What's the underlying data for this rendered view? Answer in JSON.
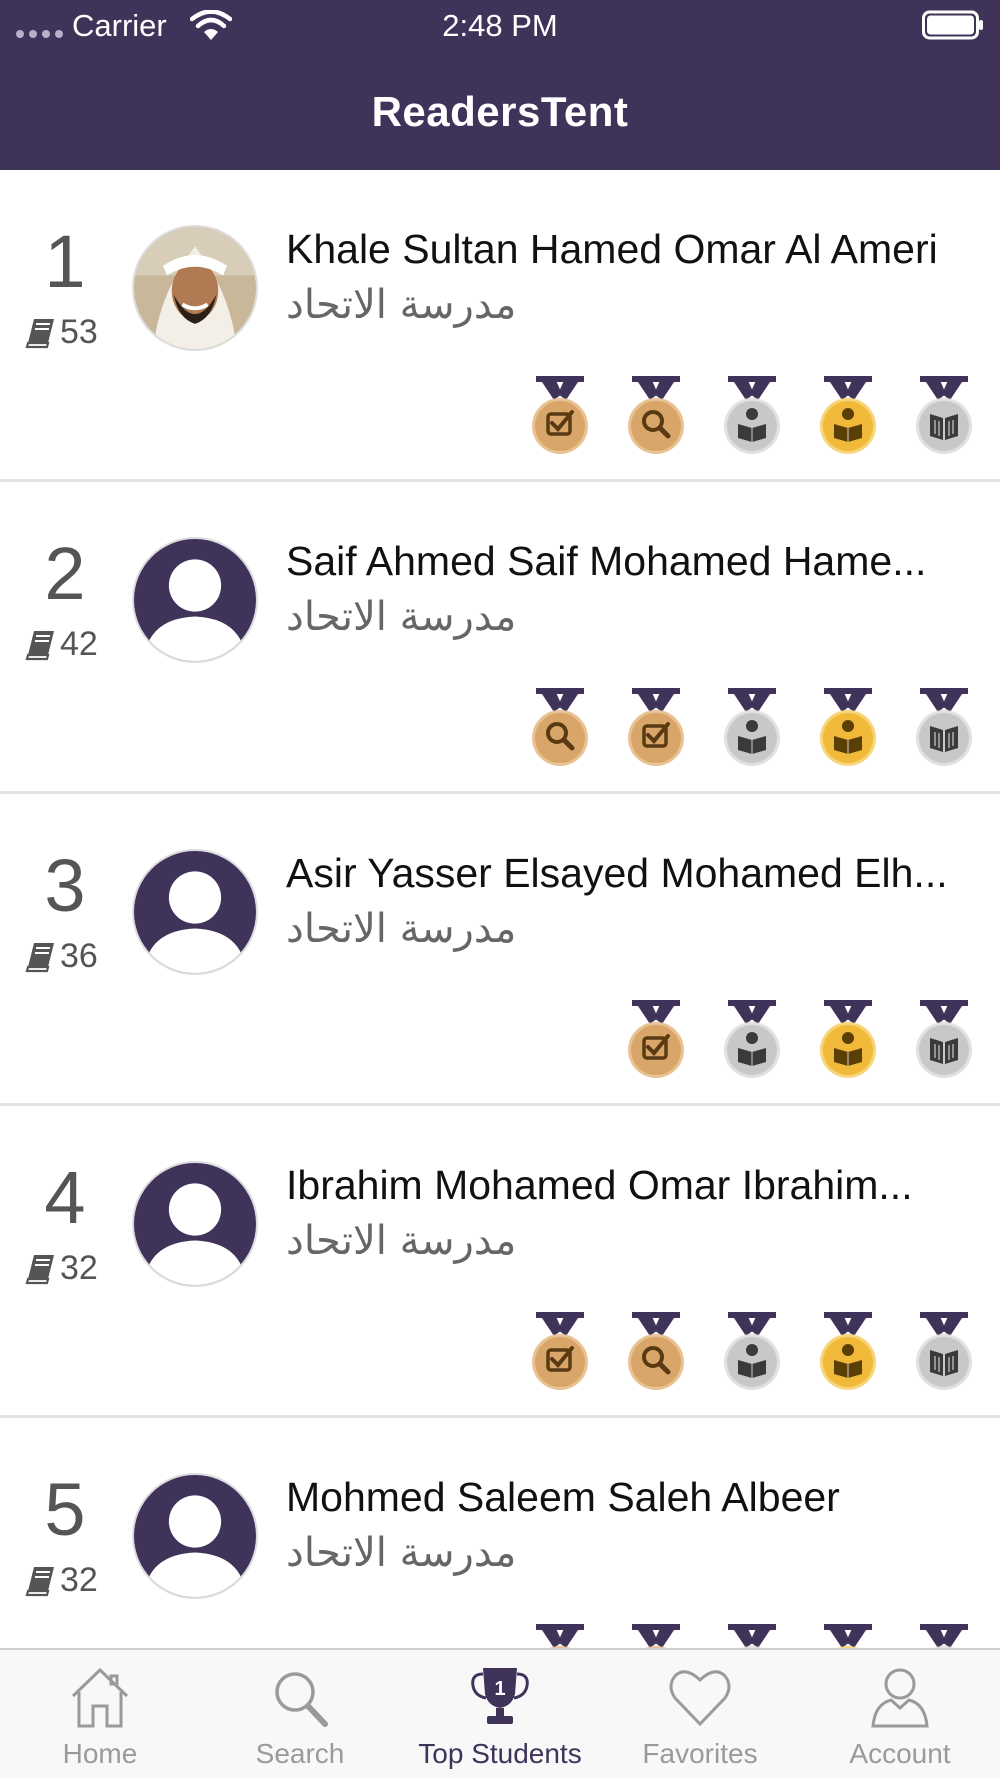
{
  "status_bar": {
    "carrier": "Carrier",
    "time": "2:48 PM"
  },
  "header": {
    "title": "ReadersTent"
  },
  "colors": {
    "brand": "#3f3359",
    "medal_bronze": "#d9a66a",
    "medal_silver": "#c8c8c8",
    "medal_gold": "#f0b93a"
  },
  "students": [
    {
      "rank": "1",
      "books": "53",
      "name": "Khale Sultan Hamed Omar Al Ameri",
      "school": "مدرسة الاتحاد",
      "avatar": "photo",
      "medals": [
        {
          "tier": "bronze",
          "icon": "checkbox-icon"
        },
        {
          "tier": "bronze",
          "icon": "magnifier-icon"
        },
        {
          "tier": "silver",
          "icon": "reader-icon"
        },
        {
          "tier": "gold",
          "icon": "reader-icon"
        },
        {
          "tier": "silver",
          "icon": "open-book-icon"
        }
      ]
    },
    {
      "rank": "2",
      "books": "42",
      "name": "Saif Ahmed Saif Mohamed Hame...",
      "school": "مدرسة الاتحاد",
      "avatar": "placeholder",
      "medals": [
        {
          "tier": "bronze",
          "icon": "magnifier-icon"
        },
        {
          "tier": "bronze",
          "icon": "checkbox-icon"
        },
        {
          "tier": "silver",
          "icon": "reader-icon"
        },
        {
          "tier": "gold",
          "icon": "reader-icon"
        },
        {
          "tier": "silver",
          "icon": "open-book-icon"
        }
      ]
    },
    {
      "rank": "3",
      "books": "36",
      "name": "Asir Yasser Elsayed Mohamed Elh...",
      "school": "مدرسة الاتحاد",
      "avatar": "placeholder",
      "medals": [
        {
          "tier": "bronze",
          "icon": "checkbox-icon"
        },
        {
          "tier": "silver",
          "icon": "reader-icon"
        },
        {
          "tier": "gold",
          "icon": "reader-icon"
        },
        {
          "tier": "silver",
          "icon": "open-book-icon"
        }
      ]
    },
    {
      "rank": "4",
      "books": "32",
      "name": "Ibrahim Mohamed Omar Ibrahim...",
      "school": "مدرسة الاتحاد",
      "avatar": "placeholder",
      "medals": [
        {
          "tier": "bronze",
          "icon": "checkbox-icon"
        },
        {
          "tier": "bronze",
          "icon": "magnifier-icon"
        },
        {
          "tier": "silver",
          "icon": "reader-icon"
        },
        {
          "tier": "gold",
          "icon": "reader-icon"
        },
        {
          "tier": "silver",
          "icon": "open-book-icon"
        }
      ]
    },
    {
      "rank": "5",
      "books": "32",
      "name": "Mohmed Saleem Saleh Albeer",
      "school": "مدرسة الاتحاد",
      "avatar": "placeholder",
      "medals": [
        {
          "tier": "bronze",
          "icon": "checkbox-icon"
        },
        {
          "tier": "bronze",
          "icon": "magnifier-icon"
        },
        {
          "tier": "silver",
          "icon": "reader-icon"
        },
        {
          "tier": "gold",
          "icon": "reader-icon"
        },
        {
          "tier": "silver",
          "icon": "open-book-icon"
        }
      ]
    }
  ],
  "tabs": [
    {
      "label": "Home",
      "icon": "home-icon",
      "active": false
    },
    {
      "label": "Search",
      "icon": "search-icon",
      "active": false
    },
    {
      "label": "Top Students",
      "icon": "trophy-icon",
      "active": true,
      "badge": "1"
    },
    {
      "label": "Favorites",
      "icon": "heart-icon",
      "active": false
    },
    {
      "label": "Account",
      "icon": "person-icon",
      "active": false
    }
  ]
}
